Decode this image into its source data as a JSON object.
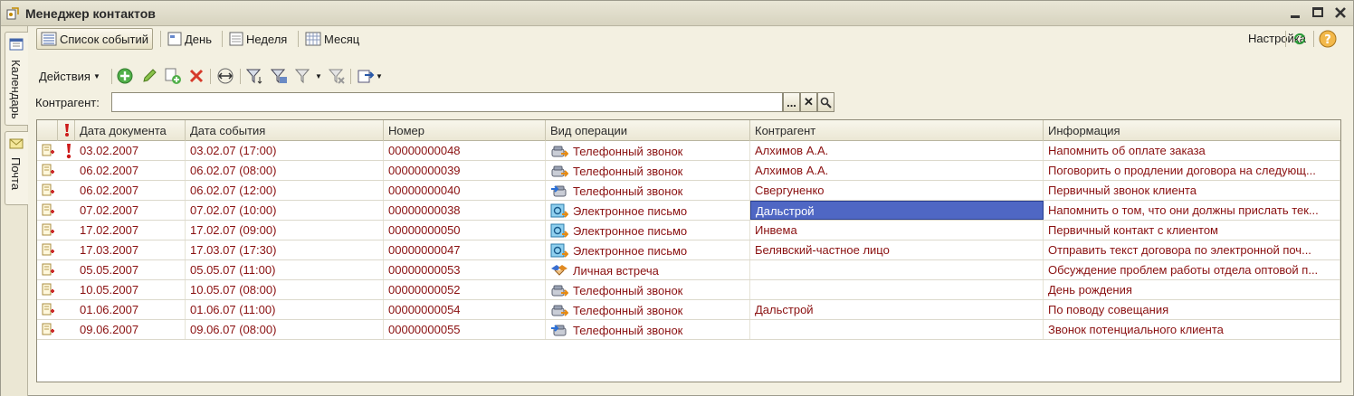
{
  "window": {
    "title": "Менеджер контактов"
  },
  "side_tabs": [
    "Календарь",
    "Почта"
  ],
  "views": [
    "Список событий",
    "День",
    "Неделя",
    "Месяц"
  ],
  "settings_label": "Настройка",
  "toolbar": {
    "actions_label": "Действия"
  },
  "filter": {
    "label": "Контрагент:",
    "value": "",
    "ellipsis": "...",
    "clear": "✕"
  },
  "columns": [
    "Дата документа",
    "Дата события",
    "Номер",
    "Вид операции",
    "Контрагент",
    "Информация"
  ],
  "rows": [
    {
      "flag": true,
      "doc_date": "03.02.2007",
      "event_date": "03.02.07 (17:00)",
      "number": "00000000048",
      "op_type": "Телефонный звонок",
      "op_icon": "phone-out-icon",
      "counterparty": "Алхимов А.А.",
      "info": "Напомнить об оплате заказа"
    },
    {
      "flag": false,
      "doc_date": "06.02.2007",
      "event_date": "06.02.07 (08:00)",
      "number": "00000000039",
      "op_type": "Телефонный звонок",
      "op_icon": "phone-out-icon",
      "counterparty": "Алхимов А.А.",
      "info": "Поговорить о продлении договора на следующ..."
    },
    {
      "flag": false,
      "doc_date": "06.02.2007",
      "event_date": "06.02.07 (12:00)",
      "number": "00000000040",
      "op_type": "Телефонный звонок",
      "op_icon": "phone-in-icon",
      "counterparty": "Свергуненко",
      "info": "Первичный звонок клиента"
    },
    {
      "flag": false,
      "doc_date": "07.02.2007",
      "event_date": "07.02.07 (10:00)",
      "number": "00000000038",
      "op_type": "Электронное письмо",
      "op_icon": "email-out-icon",
      "counterparty": "Дальстрой",
      "info": "Напомнить о том, что они должны прислать тек...",
      "selected_col": "counterparty"
    },
    {
      "flag": false,
      "doc_date": "17.02.2007",
      "event_date": "17.02.07 (09:00)",
      "number": "00000000050",
      "op_type": "Электронное письмо",
      "op_icon": "email-out-icon",
      "counterparty": "Инвема",
      "info": "Первичный контакт с клиентом"
    },
    {
      "flag": false,
      "doc_date": "17.03.2007",
      "event_date": "17.03.07 (17:30)",
      "number": "00000000047",
      "op_type": "Электронное письмо",
      "op_icon": "email-out-icon",
      "counterparty": "Белявский-частное лицо",
      "info": "Отправить текст договора по электронной поч..."
    },
    {
      "flag": false,
      "doc_date": "05.05.2007",
      "event_date": "05.05.07 (11:00)",
      "number": "00000000053",
      "op_type": "Личная встреча",
      "op_icon": "meeting-icon",
      "counterparty": "",
      "info": "Обсуждение проблем работы отдела оптовой п..."
    },
    {
      "flag": false,
      "doc_date": "10.05.2007",
      "event_date": "10.05.07 (08:00)",
      "number": "00000000052",
      "op_type": "Телефонный звонок",
      "op_icon": "phone-out-icon",
      "counterparty": "",
      "info": "День рождения"
    },
    {
      "flag": false,
      "doc_date": "01.06.2007",
      "event_date": "01.06.07 (11:00)",
      "number": "00000000054",
      "op_type": "Телефонный звонок",
      "op_icon": "phone-out-icon",
      "counterparty": "Дальстрой",
      "info": "По поводу совещания"
    },
    {
      "flag": false,
      "doc_date": "09.06.2007",
      "event_date": "09.06.07 (08:00)",
      "number": "00000000055",
      "op_type": "Телефонный звонок",
      "op_icon": "phone-in-icon",
      "counterparty": "",
      "info": "Звонок потенциального клиента"
    }
  ],
  "colors": {
    "row_text": "#8a1010",
    "selection": "#4f67c4",
    "window_bg": "#f3f0e1"
  }
}
